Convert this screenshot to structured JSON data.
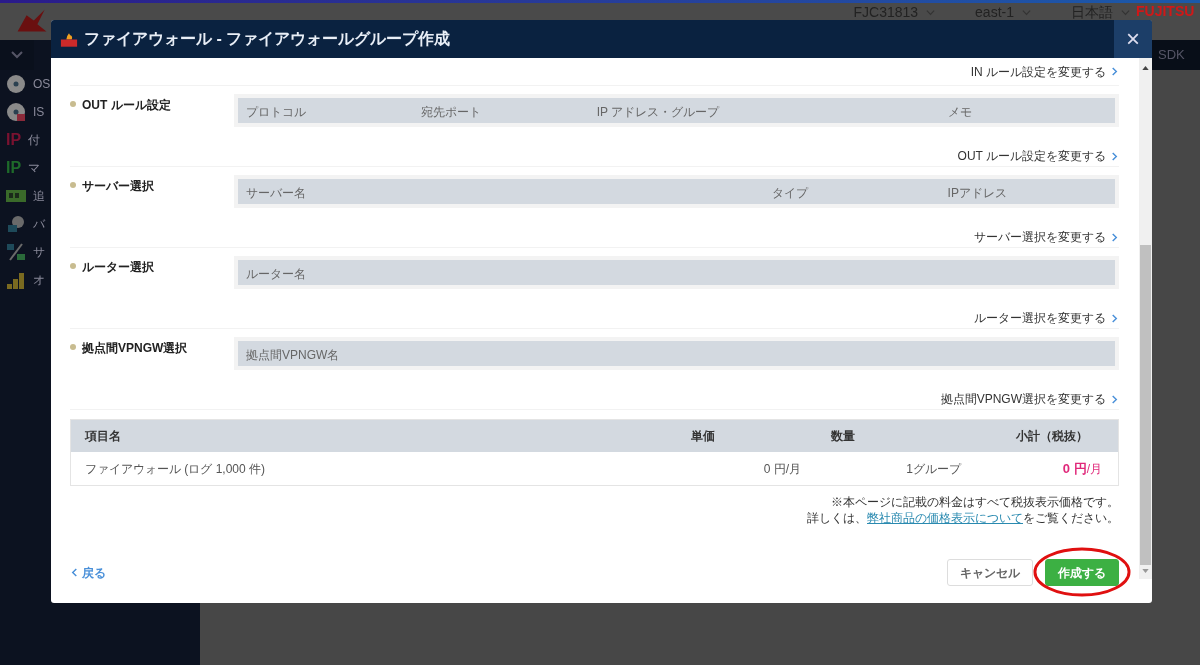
{
  "app": {
    "header_items": [
      {
        "label": "FJC31813"
      },
      {
        "label": "east-1"
      },
      {
        "label": "日本語"
      }
    ],
    "logo": "FUJITSU",
    "nav_right": "SDK",
    "sidebar": [
      {
        "label": "OS"
      },
      {
        "label": "IS"
      },
      {
        "label": "付",
        "badge": "IP"
      },
      {
        "label": "マ",
        "badge": "IP"
      },
      {
        "label": "追"
      },
      {
        "label": "バ"
      },
      {
        "label": "サ"
      },
      {
        "label": "オ"
      }
    ]
  },
  "dialog": {
    "title": "ファイアウォール - ファイアウォールグループ作成",
    "close": "×",
    "top_link": "IN ルール設定を変更する",
    "sections": [
      {
        "label": "OUT ルール設定",
        "columns": [
          "プロトコル",
          "宛先ポート",
          "IP アドレス・グループ",
          "メモ"
        ],
        "link": "OUT ルール設定を変更する"
      },
      {
        "label": "サーバー選択",
        "columns": [
          "サーバー名",
          "タイプ",
          "IPアドレス"
        ],
        "link": "サーバー選択を変更する"
      },
      {
        "label": "ルーター選択",
        "columns": [
          "ルーター名"
        ],
        "link": "ルーター選択を変更する"
      },
      {
        "label": "拠点間VPNGW選択",
        "columns": [
          "拠点間VPNGW名"
        ],
        "link": "拠点間VPNGW選択を変更する"
      }
    ],
    "price_table": {
      "columns": [
        "項目名",
        "単価",
        "数量",
        "小計（税抜）"
      ],
      "rows": [
        {
          "item": "ファイアウォール (ログ 1,000 件)",
          "unit_price": "0 円/月",
          "quantity": "1グループ",
          "subtotal": "0 円",
          "subtotal_unit": "/月"
        }
      ]
    },
    "notes": [
      "※本ページに記載の料金はすべて税抜表示価格です。"
    ],
    "note_prefix": "詳しくは、",
    "note_link": "弊社商品の価格表示について",
    "note_suffix": "をご覧ください。",
    "back": "戻る",
    "buttons": [
      {
        "label": "キャンセル",
        "kind": "secondary",
        "highlighted": false
      },
      {
        "label": "作成する",
        "kind": "primary",
        "highlighted": true
      }
    ]
  }
}
